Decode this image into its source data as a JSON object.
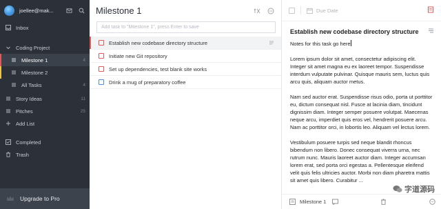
{
  "account": {
    "name": "joellee@mak..."
  },
  "sidebar": {
    "items": [
      {
        "label": "Inbox",
        "count": "",
        "icon": "inbox-icon"
      },
      {
        "label": "Coding Project",
        "count": "",
        "icon": "chevron-down-icon"
      },
      {
        "label": "Milestone 1",
        "count": "4",
        "icon": "list-icon",
        "bar_color": "#e05a5a",
        "active": true
      },
      {
        "label": "Milestone 2",
        "count": "",
        "icon": "list-icon",
        "bar_color": "#e8c547"
      },
      {
        "label": "All Tasks",
        "count": "4",
        "icon": "list-icon"
      },
      {
        "label": "Story Ideas",
        "count": "11",
        "icon": "list-icon"
      },
      {
        "label": "Pitches",
        "count": "25",
        "icon": "list-icon"
      },
      {
        "label": "Add List",
        "count": "",
        "icon": "plus-icon"
      },
      {
        "label": "Completed",
        "count": "",
        "icon": "check-square-icon"
      },
      {
        "label": "Trash",
        "count": "",
        "icon": "trash-icon"
      }
    ],
    "upgrade_label": "Upgrade to Pro"
  },
  "tasklist": {
    "title": "Milestone 1",
    "add_placeholder": "Add task to \"Milestone 1\", press Enter to save",
    "tasks": [
      {
        "title": "Establish new codebase directory structure",
        "priority_color": "#e05a5a",
        "selected": true,
        "has_note": true
      },
      {
        "title": "Initiate new Git repository",
        "priority_color": "#e05a5a"
      },
      {
        "title": "Set up dependencies, test blank site works",
        "priority_color": "#e05a5a"
      },
      {
        "title": "Drink a mug of preparatory coffee",
        "priority_color": "#4a90d9"
      }
    ]
  },
  "detail": {
    "due_placeholder": "Due Date",
    "title": "Establish new codebase directory structure",
    "notes_first": "Notes for this task go here",
    "paragraphs": [
      "Lorem ipsum dolor sit amet, consectetur adipiscing elit. Integer sit amet magna eu ex laoreet tempor. Suspendisse interdum vulputate pulvinar. Quisque mauris sem, luctus quis arcu quis, aliquam auctor metus.",
      "Nam sed auctor erat. Suspendisse risus odio, porta ut porttitor eu, dictum consequat nisl. Fusce at lacinia diam, tincidunt dignissim diam. Integer semper posuere volutpat. Maecenas neque arcu, imperdiet quis eros vel, hendrerit posuere arcu. Nam ac porttitor orci, in lobortis leo. Aliquam vel lectus lorem.",
      "Vestibulum posuere turpis sed neque blandit rhoncus bibendum non libero. Donec consequat viverra urna, nec rutrum nunc. Mauris laoreet auctor diam. Integer accumsan lorem erat, sed porta orci egestas a. Pellentesque eleifend velit quis felis ultricies auctor. Morbi non diam pharetra mattis sit amet quis libero. Curabitur ..."
    ],
    "footer_list": "Milestone 1"
  },
  "watermark": {
    "text": "字道源码"
  },
  "colors": {
    "sidebar_bg": "#2c3139",
    "priority_high": "#e05a5a",
    "priority_low": "#4a90d9",
    "milestone2": "#e8c547"
  }
}
